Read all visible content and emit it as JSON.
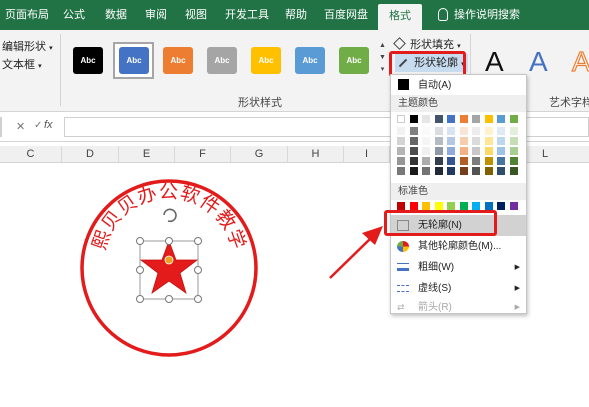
{
  "ribbon_tabs": [
    {
      "label": "页面布局"
    },
    {
      "label": "公式"
    },
    {
      "label": "数据"
    },
    {
      "label": "审阅"
    },
    {
      "label": "视图"
    },
    {
      "label": "开发工具"
    },
    {
      "label": "帮助"
    },
    {
      "label": "百度网盘"
    },
    {
      "label": "格式",
      "active": true
    },
    {
      "label": "操作说明搜索"
    }
  ],
  "insert_group": {
    "edit_shape": "编辑形状",
    "text_box": "文本框"
  },
  "shape_styles": {
    "label": "形状样式",
    "swatch_text": "Abc",
    "swatch_colors": [
      "#000000",
      "#4472c4",
      "#ed7d31",
      "#a5a5a5",
      "#ffc000",
      "#5b9bd5",
      "#70ad47"
    ],
    "fill_button": "形状填充",
    "outline_button": "形状轮廓"
  },
  "art_styles": {
    "label": "艺术字样",
    "letter": "A"
  },
  "formula_bar": {
    "fx": "fx",
    "name_box": ""
  },
  "columns": [
    "C",
    "D",
    "E",
    "F",
    "G",
    "H",
    "I",
    "L"
  ],
  "stamp": {
    "text": "熙贝贝办公软件教学",
    "color": "#e31b1b"
  },
  "outline_menu": {
    "auto_label": "自动(A)",
    "theme_colors_header": "主题颜色",
    "theme_base": [
      "#ffffff",
      "#000000",
      "#e7e6e6",
      "#44546a",
      "#4472c4",
      "#ed7d31",
      "#a5a5a5",
      "#ffc000",
      "#5b9bd5",
      "#70ad47"
    ],
    "standard_colors_header": "标准色",
    "standard_colors": [
      "#c00000",
      "#ff0000",
      "#ffc000",
      "#ffff00",
      "#92d050",
      "#00b050",
      "#00b0f0",
      "#0070c0",
      "#002060",
      "#7030a0"
    ],
    "no_outline": "无轮廓(N)",
    "more_colors": "其他轮廓颜色(M)...",
    "weight": "粗细(W)",
    "dashes": "虚线(S)",
    "arrows": "箭头(R)"
  }
}
